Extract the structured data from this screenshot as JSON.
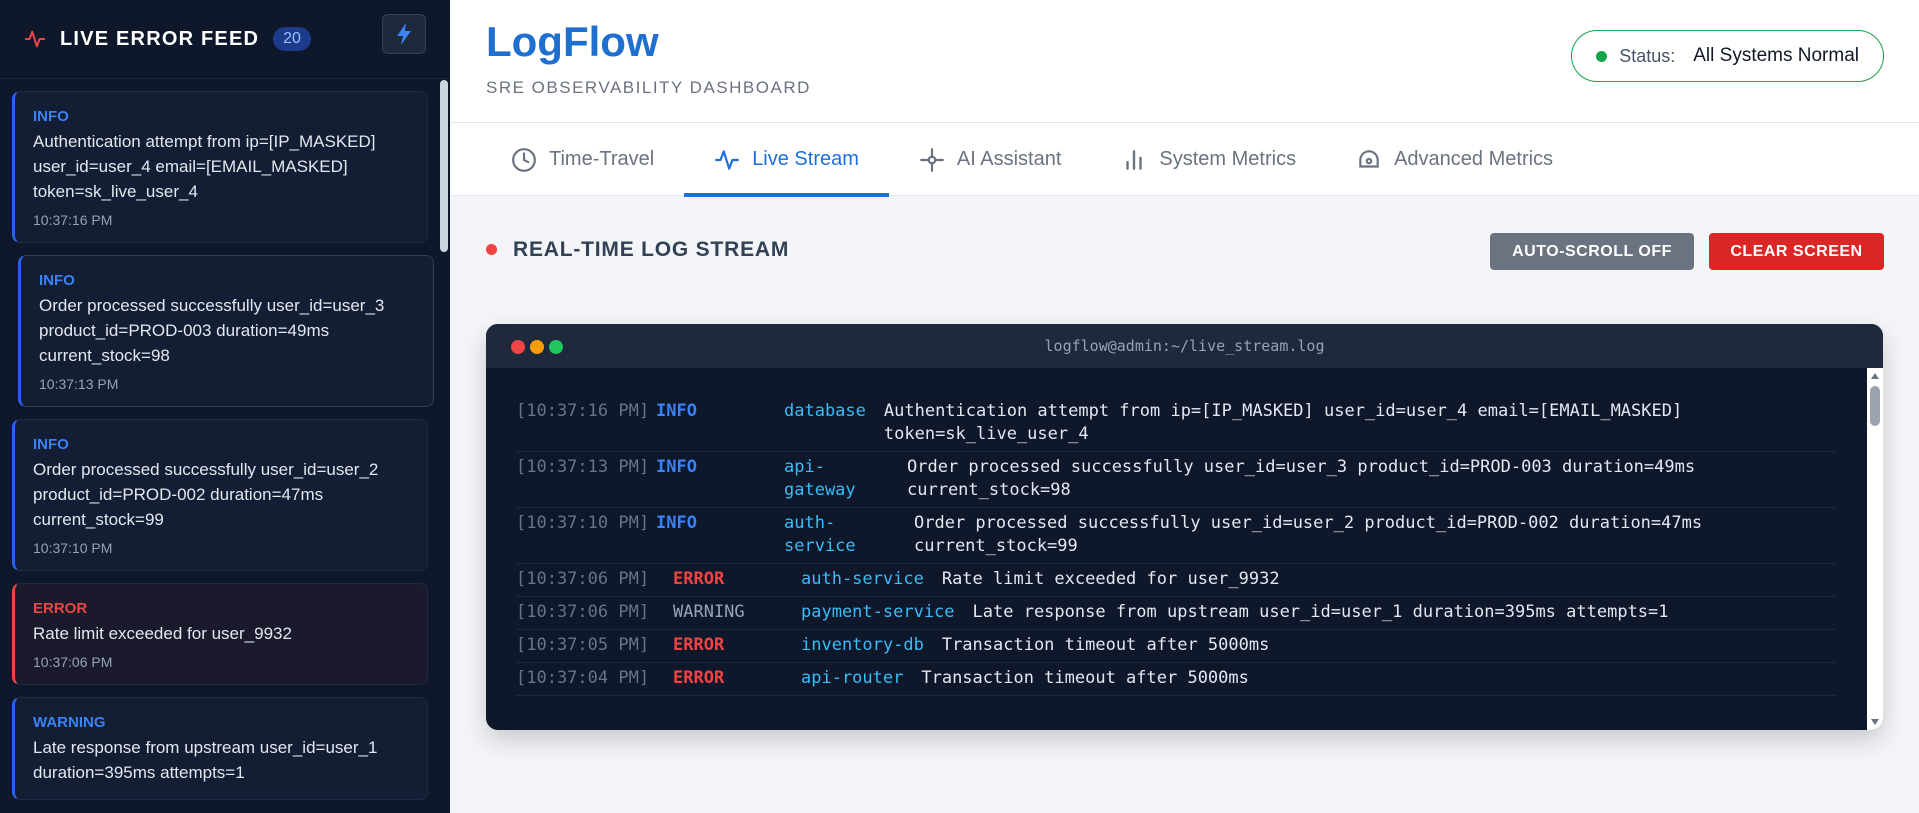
{
  "sidebar": {
    "title": "LIVE ERROR FEED",
    "count": "20",
    "cards": [
      {
        "level": "INFO",
        "message": "Authentication attempt from ip=[IP_MASKED] user_id=user_4 email=[EMAIL_MASKED] token=sk_live_user_4",
        "time": "10:37:16 PM"
      },
      {
        "level": "INFO",
        "message": "Order processed successfully user_id=user_3 product_id=PROD-003 duration=49ms current_stock=98",
        "time": "10:37:13 PM"
      },
      {
        "level": "INFO",
        "message": "Order processed successfully user_id=user_2 product_id=PROD-002 duration=47ms current_stock=99",
        "time": "10:37:10 PM"
      },
      {
        "level": "ERROR",
        "message": "Rate limit exceeded for user_9932",
        "time": "10:37:06 PM"
      },
      {
        "level": "WARNING",
        "message": "Late response from upstream user_id=user_1 duration=395ms attempts=1",
        "time": ""
      }
    ]
  },
  "header": {
    "logo": "LogFlow",
    "subtitle": "SRE OBSERVABILITY DASHBOARD",
    "status_label": "Status:",
    "status_value": "All Systems Normal",
    "status_color": "#16a34a"
  },
  "tabs": [
    {
      "label": "Time-Travel",
      "icon": "clock-icon"
    },
    {
      "label": "Live Stream",
      "icon": "pulse-icon",
      "active": true
    },
    {
      "label": "AI Assistant",
      "icon": "robot-icon"
    },
    {
      "label": "System Metrics",
      "icon": "bar-chart-icon"
    },
    {
      "label": "Advanced Metrics",
      "icon": "gauge-icon"
    }
  ],
  "stream": {
    "title": "REAL-TIME LOG STREAM",
    "autoscroll_label": "AUTO-SCROLL OFF",
    "clear_label": "CLEAR SCREEN",
    "terminal_path": "logflow@admin:~/live_stream.log",
    "logs": [
      {
        "time": "[10:37:16 PM]",
        "level": "INFO",
        "source": "database",
        "message": "Authentication attempt from ip=[IP_MASKED] user_id=user_4 email=[EMAIL_MASKED] token=sk_live_user_4"
      },
      {
        "time": "[10:37:13 PM]",
        "level": "INFO",
        "source": "api-gateway",
        "message": "Order processed successfully user_id=user_3 product_id=PROD-003 duration=49ms current_stock=98"
      },
      {
        "time": "[10:37:10 PM]",
        "level": "INFO",
        "source": "auth-service",
        "message": "Order processed successfully user_id=user_2 product_id=PROD-002 duration=47ms current_stock=99"
      },
      {
        "time": "[10:37:06 PM]",
        "level": "ERROR",
        "source": "auth-service",
        "message": "Rate limit exceeded for user_9932"
      },
      {
        "time": "[10:37:06 PM]",
        "level": "WARNING",
        "source": "payment-service",
        "message": "Late response from upstream user_id=user_1 duration=395ms attempts=1"
      },
      {
        "time": "[10:37:05 PM]",
        "level": "ERROR",
        "source": "inventory-db",
        "message": "Transaction timeout after 5000ms"
      },
      {
        "time": "[10:37:04 PM]",
        "level": "ERROR",
        "source": "api-router",
        "message": "Transaction timeout after 5000ms"
      }
    ]
  }
}
